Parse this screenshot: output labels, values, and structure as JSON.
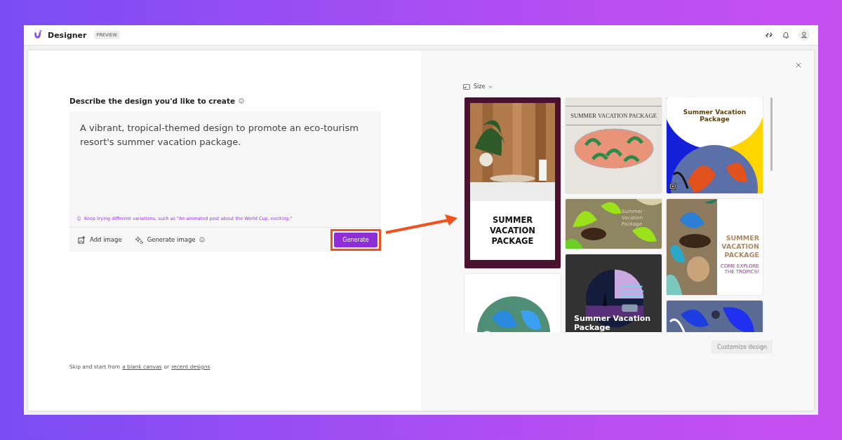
{
  "app": {
    "name": "Designer",
    "badge": "PREVIEW"
  },
  "prompt": {
    "heading": "Describe the design you'd like to create",
    "value": "A vibrant, tropical-themed design to promote an eco-tourism resort's summer vacation package.",
    "hint": "Keep trying different variations, such as \"An animated post about the World Cup, exciting.\"",
    "actions": [
      "Add image",
      "Generate image"
    ],
    "generate": "Generate"
  },
  "footer": {
    "lead": "Skip and start from",
    "link1": "a blank canvas",
    "mid": "or",
    "link2": "recent designs"
  },
  "gallery": {
    "size_label": "Size",
    "columns": [
      [
        {
          "title": "SUMMER VACATION PACKAGE"
        },
        {
          "kind": "circle"
        }
      ],
      [
        {
          "kind": "oval",
          "title": "SUMMER VACATION PACKAGE"
        },
        {
          "kind": "leaves",
          "title": "Summer Vacation Package"
        },
        {
          "kind": "night",
          "title": "Summer Vacation Package"
        }
      ],
      [
        {
          "kind": "arc",
          "title": "Summer Vacation Package",
          "video": true
        },
        {
          "kind": "split",
          "title": "SUMMER VACATION PACKAGE",
          "subtitle": "COME EXPLORE THE TROPICS!"
        },
        {
          "kind": "pattern"
        }
      ]
    ],
    "customize": {
      "label": "Customize design",
      "disabled": true
    }
  }
}
